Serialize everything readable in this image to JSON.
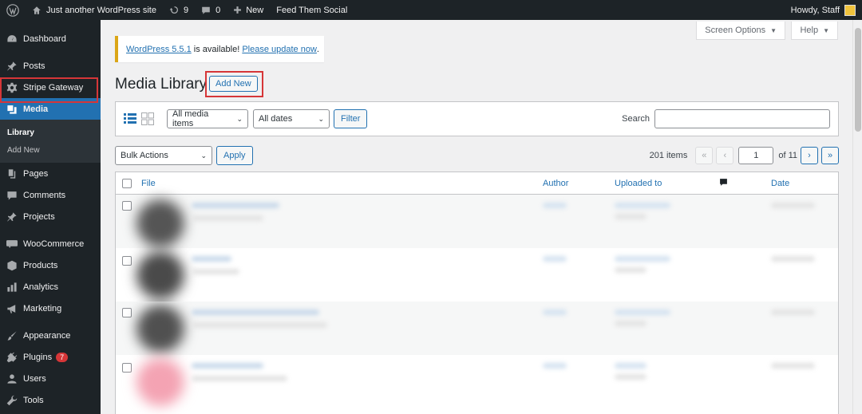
{
  "adminbar": {
    "site_name": "Just another WordPress site",
    "updates_count": "9",
    "comments_count": "0",
    "new_label": "New",
    "plugin_link": "Feed Them Social",
    "greeting": "Howdy, Staff"
  },
  "sidebar": {
    "items": [
      {
        "label": "Dashboard",
        "icon": "dashboard-icon"
      },
      {
        "label": "Posts",
        "icon": "pin-icon"
      },
      {
        "label": "Stripe Gateway",
        "icon": "gear-icon"
      },
      {
        "label": "Media",
        "icon": "media-icon"
      },
      {
        "label": "Pages",
        "icon": "pages-icon"
      },
      {
        "label": "Comments",
        "icon": "comment-icon"
      },
      {
        "label": "Projects",
        "icon": "pin-icon"
      },
      {
        "label": "WooCommerce",
        "icon": "woo-icon"
      },
      {
        "label": "Products",
        "icon": "box-icon"
      },
      {
        "label": "Analytics",
        "icon": "bar-chart-icon"
      },
      {
        "label": "Marketing",
        "icon": "megaphone-icon"
      },
      {
        "label": "Appearance",
        "icon": "brush-icon"
      },
      {
        "label": "Plugins",
        "icon": "plug-icon",
        "badge": "7"
      },
      {
        "label": "Users",
        "icon": "user-icon"
      },
      {
        "label": "Tools",
        "icon": "wrench-icon"
      }
    ],
    "media_submenu": [
      "Library",
      "Add New"
    ]
  },
  "header": {
    "screen_options": "Screen Options",
    "help": "Help"
  },
  "notice": {
    "version_link": "WordPress 5.5.1",
    "middle": " is available! ",
    "update_link": "Please update now",
    "end": "."
  },
  "page": {
    "title": "Media Library",
    "add_new": "Add New"
  },
  "filters": {
    "type_select": "All media items",
    "date_select": "All dates",
    "filter_button": "Filter",
    "search_label": "Search",
    "search_value": ""
  },
  "bulk": {
    "select": "Bulk Actions",
    "apply": "Apply"
  },
  "pagination": {
    "items_count": "201 items",
    "first": "«",
    "prev": "‹",
    "current_page": "1",
    "of_total": "of 11",
    "next": "›",
    "last": "»"
  },
  "table": {
    "columns": [
      "File",
      "Author",
      "Uploaded to",
      "Date"
    ]
  },
  "colors": {
    "accent": "#2271b1",
    "sidebar_bg": "#1d2327",
    "highlight": "#d63638"
  }
}
